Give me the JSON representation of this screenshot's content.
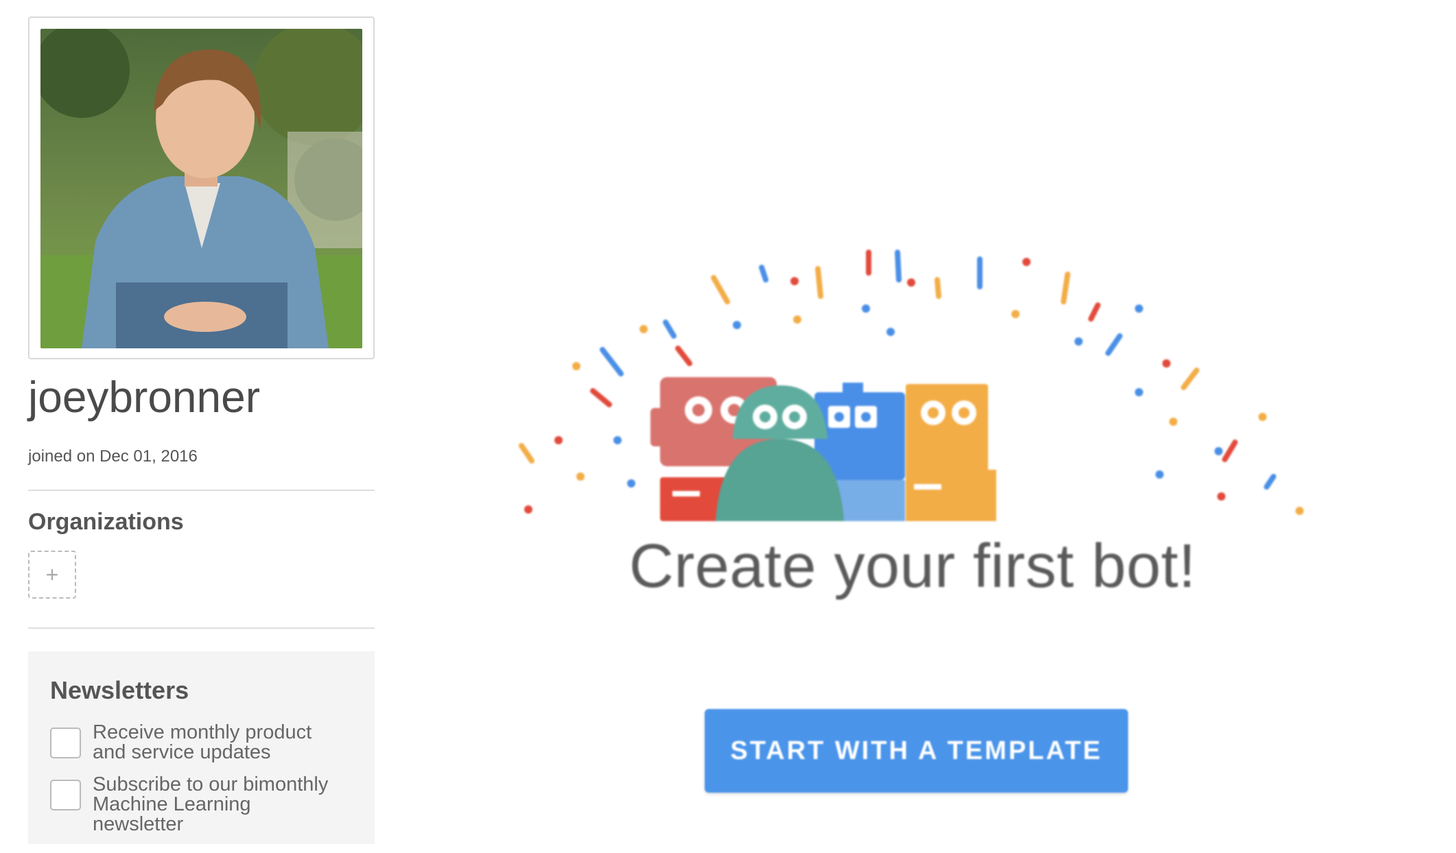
{
  "profile": {
    "username": "joeybronner",
    "joined": "joined on Dec 01, 2016",
    "avatar_icon": "profile-photo"
  },
  "organizations": {
    "title": "Organizations",
    "add_label": "+"
  },
  "newsletters": {
    "title": "Newsletters",
    "items": [
      {
        "label": "Receive monthly product and service updates",
        "checked": false
      },
      {
        "label": "Subscribe to our bimonthly Machine Learning newsletter",
        "checked": false
      }
    ]
  },
  "empty_state": {
    "headline": "Create your first bot!",
    "cta_label": "START WITH A TEMPLATE"
  },
  "colors": {
    "primary_button": "#4a94ea",
    "robot_red": "#d9736e",
    "robot_green": "#5fad9f",
    "robot_blue": "#4a8fe7",
    "robot_orange": "#f3ad47"
  }
}
